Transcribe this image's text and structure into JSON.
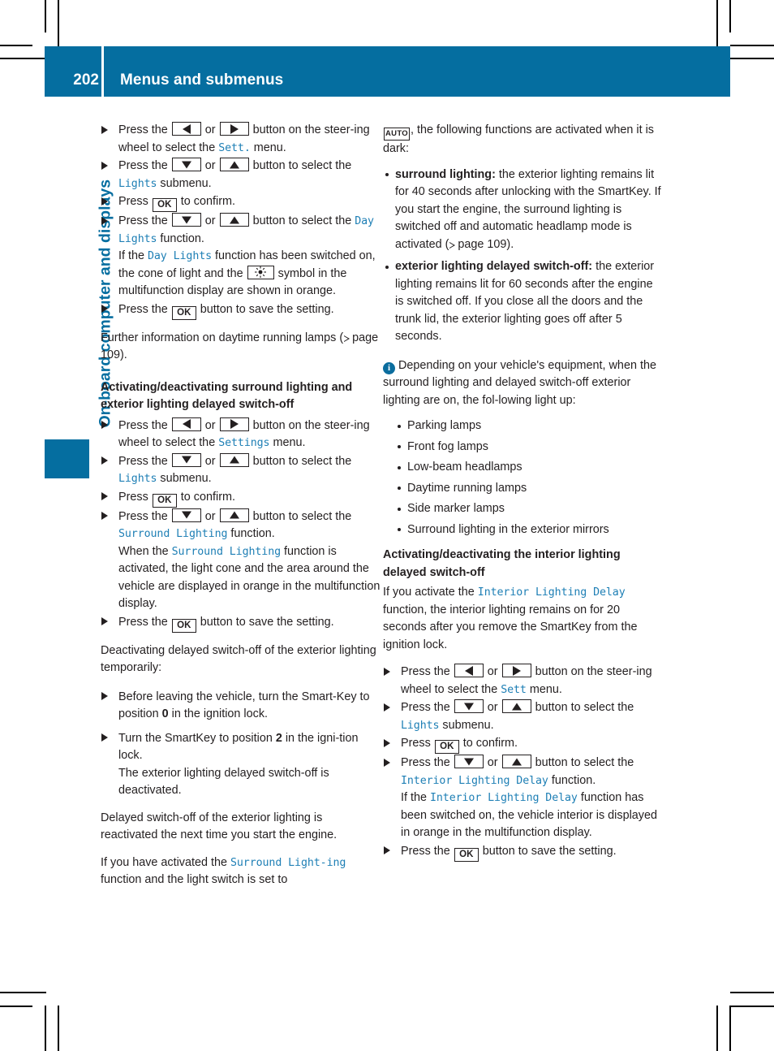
{
  "header": {
    "page_number": "202",
    "title": "Menus and submenus",
    "bar_color": "#056EA0"
  },
  "chapter_tab": {
    "vertical_title": "On-board computer and displays",
    "color": "#056EA0"
  },
  "icons": {
    "left_arrow": "left-arrow-key",
    "right_arrow": "right-arrow-key",
    "up_arrow": "up-arrow-key",
    "down_arrow": "down-arrow-key",
    "ok": "OK",
    "auto": "AUTO",
    "sun": "daytime-running-lamp-symbol",
    "info": "i",
    "page_ref": "page-reference-arrow"
  },
  "left_column": {
    "steps_day_lights": [
      {
        "pre": "Press the ",
        "mid": " or ",
        "post": " button on the steer-ing wheel to select the ",
        "mfd": "Sett.",
        "tail": " menu.",
        "keys": [
          "left",
          "right"
        ]
      },
      {
        "pre": "Press the ",
        "mid": " or ",
        "post": " button to select the ",
        "mfd": "Lights",
        "tail": " submenu.",
        "keys": [
          "down",
          "up"
        ]
      },
      {
        "pre": "Press ",
        "post": " to confirm.",
        "keys": [
          "ok"
        ]
      },
      {
        "pre": "Press the ",
        "mid": " or ",
        "post": " button to select the ",
        "mfd": "Day Lights",
        "tail": " function.",
        "keys": [
          "down",
          "up"
        ]
      }
    ],
    "day_lights_note_1": "If the ",
    "day_lights_note_mfd": "Day Lights",
    "day_lights_note_2": " function has been switched on, the cone of light and the ",
    "day_lights_note_3": " symbol in the multifunction display are shown in orange.",
    "save_step": {
      "pre": "Press the ",
      "post": " button to save the setting."
    },
    "further_info": "Further information on daytime running lamps (",
    "further_info_page": "page 109",
    "further_info_end": ").",
    "heading_surround": "Activating/deactivating surround lighting and exterior lighting delayed switch-off",
    "steps_surround": [
      {
        "pre": "Press the ",
        "mid": " or ",
        "post": " button on the steer-ing wheel to select the ",
        "mfd": "Settings",
        "tail": " menu.",
        "keys": [
          "left",
          "right"
        ]
      },
      {
        "pre": "Press the ",
        "mid": " or ",
        "post": " button to select the ",
        "mfd": "Lights",
        "tail": " submenu.",
        "keys": [
          "down",
          "up"
        ]
      },
      {
        "pre": "Press ",
        "post": " to confirm.",
        "keys": [
          "ok"
        ]
      },
      {
        "pre": "Press the ",
        "mid": " or ",
        "post": " button to select the ",
        "mfd": "Surround Lighting",
        "tail": " function.",
        "keys": [
          "down",
          "up"
        ]
      }
    ],
    "surround_note_1": "When the ",
    "surround_note_mfd": "Surround Lighting",
    "surround_note_2": " function is activated, the light cone and the area around the vehicle are displayed in orange in the multifunction display.",
    "surround_save": {
      "pre": "Press the ",
      "post": " button to save the setting."
    },
    "deactivating_intro": "Deactivating delayed switch-off of the exterior lighting temporarily:",
    "deactivating_steps": [
      "Before leaving the vehicle, turn the Smart-Key to position 0 in the ignition lock.",
      "Turn the SmartKey to position 2 in the igni-tion lock."
    ],
    "deactivating_step2_note": "The exterior lighting delayed switch-off is deactivated.",
    "reactivated_para": "Delayed switch-off of the exterior lighting is reactivated the next time you start the engine.",
    "carryover_1": "If you have activated the ",
    "carryover_mfd": "Surround Light-ing",
    "carryover_2": " function and the light switch is set to"
  },
  "right_column": {
    "auto_intro": ", the following functions are activated when it is dark:",
    "functions": [
      {
        "term": "surround lighting:",
        "text": " the exterior lighting remains lit for 40 seconds after unlocking with the SmartKey. If you start the engine, the surround lighting is switched off and automatic headlamp mode is activated (",
        "page_ref": "page 109",
        "text_end": ")."
      },
      {
        "term": "exterior lighting delayed switch-off:",
        "text": " the exterior lighting remains lit for 60 seconds after the engine is switched off. If you close all the doors and the trunk lid, the exterior lighting goes off after 5 seconds.",
        "page_ref": "",
        "text_end": ""
      }
    ],
    "note_text": " Depending on your vehicle's equipment, when the surround lighting and delayed switch-off exterior lighting are on, the fol-lowing light up:",
    "note_items": [
      "Parking lamps",
      "Front fog lamps",
      "Low-beam headlamps",
      "Daytime running lamps",
      "Side marker lamps",
      "Surround lighting in the exterior mirrors"
    ],
    "heading_interior": "Activating/deactivating the interior lighting delayed switch-off",
    "interior_intro_1": "If you activate the ",
    "interior_intro_mfd": "Interior Lighting Delay",
    "interior_intro_2": " function, the interior lighting remains on for 20 seconds after you remove the SmartKey from the ignition lock.",
    "steps_interior": [
      {
        "pre": "Press the ",
        "mid": " or ",
        "post": " button on the steer-ing wheel to select the ",
        "mfd": "Sett",
        "tail": " menu.",
        "keys": [
          "left",
          "right"
        ]
      },
      {
        "pre": "Press the ",
        "mid": " or ",
        "post": " button to select the ",
        "mfd": "Lights",
        "tail": " submenu.",
        "keys": [
          "down",
          "up"
        ]
      },
      {
        "pre": "Press ",
        "post": " to confirm.",
        "keys": [
          "ok"
        ]
      },
      {
        "pre": "Press the ",
        "mid": " or ",
        "post": " button to select the ",
        "mfd": "Interior Lighting Delay",
        "tail": " function.",
        "keys": [
          "down",
          "up"
        ]
      }
    ],
    "interior_note_1": "If the ",
    "interior_note_mfd": "Interior Lighting Delay",
    "interior_note_2": " function has been switched on, the vehicle interior is displayed in orange in the multifunction display.",
    "interior_save": {
      "pre": "Press the ",
      "post": " button to save the setting."
    }
  }
}
